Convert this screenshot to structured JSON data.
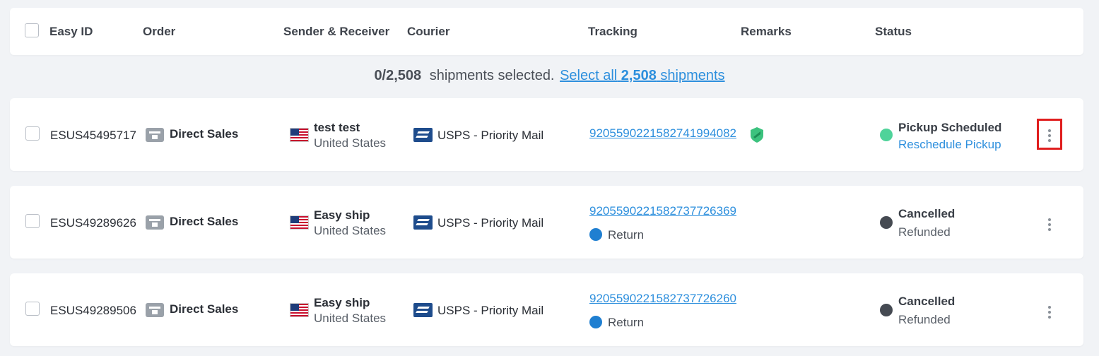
{
  "header": {
    "columns": [
      "Easy ID",
      "Order",
      "Sender & Receiver",
      "Courier",
      "Tracking",
      "Remarks",
      "Status"
    ]
  },
  "selection": {
    "count": "0/2,508",
    "text": "shipments selected.",
    "link_prefix": "Select all",
    "link_count": "2,508",
    "link_suffix": "shipments"
  },
  "rows": [
    {
      "easy_id": "ESUS45495717",
      "order": "Direct Sales",
      "receiver_name": "test test",
      "receiver_country": "United States",
      "courier": "USPS - Priority Mail",
      "tracking": "9205590221582741994082",
      "status_title": "Pickup Scheduled",
      "status_action": "Reschedule Pickup",
      "status_color": "#4fd39a"
    },
    {
      "easy_id": "ESUS49289626",
      "order": "Direct Sales",
      "receiver_name": "Easy ship",
      "receiver_country": "United States",
      "courier": "USPS - Priority Mail",
      "tracking": "9205590221582737726369",
      "tag": "Return",
      "status_title": "Cancelled",
      "status_sub": "Refunded",
      "status_color": "#454a52"
    },
    {
      "easy_id": "ESUS49289506",
      "order": "Direct Sales",
      "receiver_name": "Easy ship",
      "receiver_country": "United States",
      "courier": "USPS - Priority Mail",
      "tracking": "9205590221582737726260",
      "tag": "Return",
      "status_title": "Cancelled",
      "status_sub": "Refunded",
      "status_color": "#454a52"
    }
  ],
  "colors": {
    "accent_link": "#2d8fdd",
    "highlight_box": "#e01e1e",
    "insurance_shield": "#3cc27e"
  },
  "icons": [
    "store-icon",
    "us-flag-icon",
    "usps-logo-icon",
    "shield-icon",
    "more-options-icon"
  ]
}
